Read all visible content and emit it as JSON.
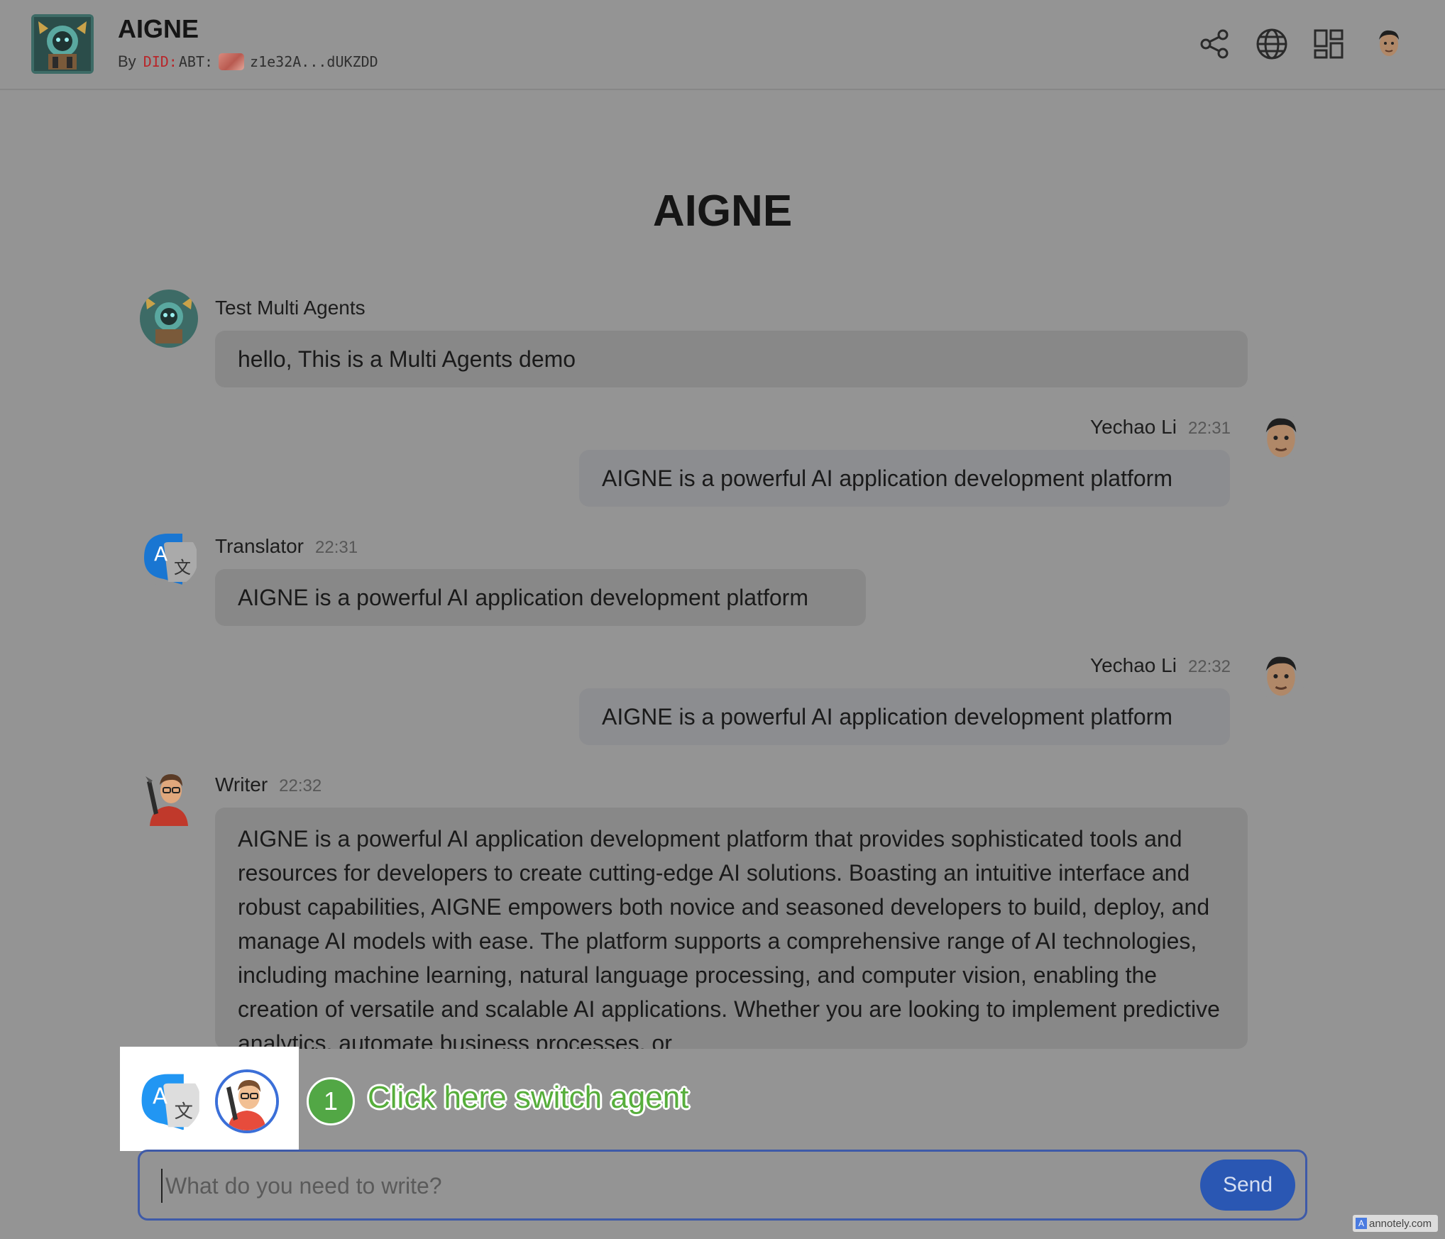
{
  "header": {
    "app_title": "AIGNE",
    "by_label": "By",
    "did_prefix": "DID:",
    "did_type": "ABT:",
    "did_short": "z1e32A...dUKZDD",
    "icons": [
      "share-icon",
      "globe-icon",
      "apps-grid-icon",
      "user-avatar"
    ]
  },
  "main": {
    "heading": "AIGNE",
    "messages": [
      {
        "sender": "Test Multi Agents",
        "time": "",
        "text": "hello, This is a Multi Agents demo",
        "side": "left",
        "avatar": "aigne-logo-avatar"
      },
      {
        "sender": "Yechao Li",
        "time": "22:31",
        "text": "AIGNE is a powerful AI application development platform",
        "side": "right",
        "avatar": "user-avatar"
      },
      {
        "sender": "Translator",
        "time": "22:31",
        "text": "AIGNE is a powerful AI application development platform",
        "side": "left",
        "avatar": "translate-icon"
      },
      {
        "sender": "Yechao Li",
        "time": "22:32",
        "text": "AIGNE is a powerful AI application development platform",
        "side": "right",
        "avatar": "user-avatar"
      },
      {
        "sender": "Writer",
        "time": "22:32",
        "text": "AIGNE is a powerful AI application development platform that provides sophisticated tools and resources for developers to create cutting-edge AI solutions. Boasting an intuitive interface and robust capabilities, AIGNE empowers both novice and seasoned developers to build, deploy, and manage AI models with ease. The platform supports a comprehensive range of AI technologies, including machine learning, natural language processing, and computer vision, enabling the creation of versatile and scalable AI applications. Whether you are looking to implement predictive analytics, automate business processes, or",
        "side": "left",
        "avatar": "writer-avatar"
      }
    ]
  },
  "agent_switcher": {
    "agents": [
      {
        "name": "Translator",
        "icon": "translate-icon",
        "selected": false
      },
      {
        "name": "Writer",
        "icon": "writer-avatar",
        "selected": true
      }
    ]
  },
  "annotation": {
    "step": "1",
    "text": "Click here switch agent",
    "color": "#57ae3c"
  },
  "composer": {
    "placeholder": "What do you need to write?",
    "value": "",
    "send_label": "Send",
    "accent": "#2a57b3"
  },
  "watermark": "annotely.com"
}
